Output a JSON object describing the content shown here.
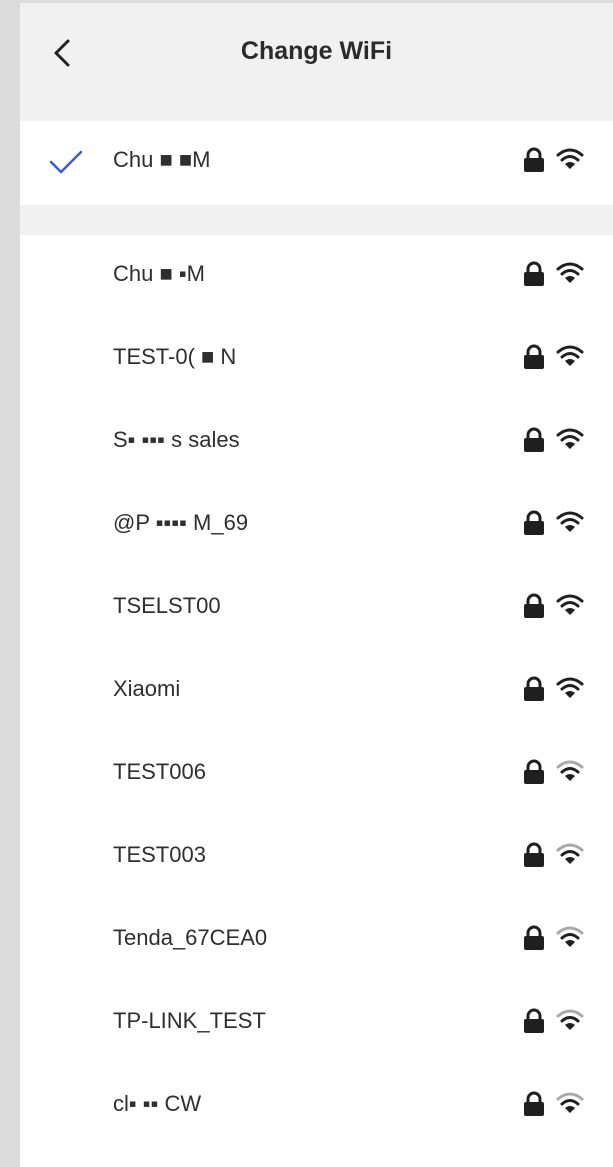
{
  "header": {
    "title": "Change WiFi"
  },
  "current": {
    "ssid": "Chu  ■ ■M",
    "signal": "strong"
  },
  "colors": {
    "accent": "#3a5bd9",
    "strong_signal": "#1f1f1f",
    "weak_signal": "#a9a9a9",
    "band": "#f1f1f1"
  },
  "networks": [
    {
      "ssid": "Chu  ■ ▪M",
      "signal": "strong"
    },
    {
      "ssid": "TEST-0(  ■  N",
      "signal": "strong"
    },
    {
      "ssid": "S▪  ▪▪▪ s sales",
      "signal": "strong"
    },
    {
      "ssid": "@P  ▪▪▪▪ M_69",
      "signal": "strong"
    },
    {
      "ssid": "TSELST00",
      "signal": "strong"
    },
    {
      "ssid": "Xiaomi",
      "signal": "strong"
    },
    {
      "ssid": "TEST006",
      "signal": "weak"
    },
    {
      "ssid": "TEST003",
      "signal": "weak"
    },
    {
      "ssid": "Tenda_67CEA0",
      "signal": "weak"
    },
    {
      "ssid": "TP-LINK_TEST",
      "signal": "weak"
    },
    {
      "ssid": "cl▪  ▪▪ CW",
      "signal": "weak"
    }
  ]
}
